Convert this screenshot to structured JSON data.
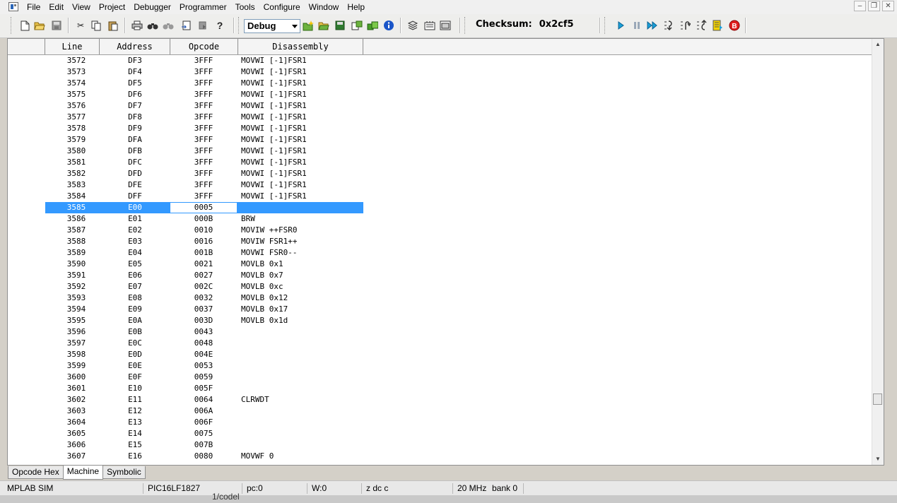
{
  "menu": [
    "File",
    "Edit",
    "View",
    "Project",
    "Debugger",
    "Programmer",
    "Tools",
    "Configure",
    "Window",
    "Help"
  ],
  "toolbar": {
    "config_select": "Debug",
    "checksum_label": "Checksum:",
    "checksum_value": "0x2cf5"
  },
  "table": {
    "headers": [
      "Line",
      "Address",
      "Opcode",
      "Disassembly"
    ],
    "selected_index": 13,
    "rows": [
      [
        "3572",
        "DF3",
        "3FFF",
        "MOVWI [-1]FSR1"
      ],
      [
        "3573",
        "DF4",
        "3FFF",
        "MOVWI [-1]FSR1"
      ],
      [
        "3574",
        "DF5",
        "3FFF",
        "MOVWI [-1]FSR1"
      ],
      [
        "3575",
        "DF6",
        "3FFF",
        "MOVWI [-1]FSR1"
      ],
      [
        "3576",
        "DF7",
        "3FFF",
        "MOVWI [-1]FSR1"
      ],
      [
        "3577",
        "DF8",
        "3FFF",
        "MOVWI [-1]FSR1"
      ],
      [
        "3578",
        "DF9",
        "3FFF",
        "MOVWI [-1]FSR1"
      ],
      [
        "3579",
        "DFA",
        "3FFF",
        "MOVWI [-1]FSR1"
      ],
      [
        "3580",
        "DFB",
        "3FFF",
        "MOVWI [-1]FSR1"
      ],
      [
        "3581",
        "DFC",
        "3FFF",
        "MOVWI [-1]FSR1"
      ],
      [
        "3582",
        "DFD",
        "3FFF",
        "MOVWI [-1]FSR1"
      ],
      [
        "3583",
        "DFE",
        "3FFF",
        "MOVWI [-1]FSR1"
      ],
      [
        "3584",
        "DFF",
        "3FFF",
        "MOVWI [-1]FSR1"
      ],
      [
        "3585",
        "E00",
        "0005",
        ""
      ],
      [
        "3586",
        "E01",
        "000B",
        "BRW"
      ],
      [
        "3587",
        "E02",
        "0010",
        "MOVIW ++FSR0"
      ],
      [
        "3588",
        "E03",
        "0016",
        "MOVIW FSR1++"
      ],
      [
        "3589",
        "E04",
        "001B",
        "MOVWI FSR0--"
      ],
      [
        "3590",
        "E05",
        "0021",
        "MOVLB 0x1"
      ],
      [
        "3591",
        "E06",
        "0027",
        "MOVLB 0x7"
      ],
      [
        "3592",
        "E07",
        "002C",
        "MOVLB 0xc"
      ],
      [
        "3593",
        "E08",
        "0032",
        "MOVLB 0x12"
      ],
      [
        "3594",
        "E09",
        "0037",
        "MOVLB 0x17"
      ],
      [
        "3595",
        "E0A",
        "003D",
        "MOVLB 0x1d"
      ],
      [
        "3596",
        "E0B",
        "0043",
        ""
      ],
      [
        "3597",
        "E0C",
        "0048",
        ""
      ],
      [
        "3598",
        "E0D",
        "004E",
        ""
      ],
      [
        "3599",
        "E0E",
        "0053",
        ""
      ],
      [
        "3600",
        "E0F",
        "0059",
        ""
      ],
      [
        "3601",
        "E10",
        "005F",
        ""
      ],
      [
        "3602",
        "E11",
        "0064",
        "CLRWDT"
      ],
      [
        "3603",
        "E12",
        "006A",
        ""
      ],
      [
        "3604",
        "E13",
        "006F",
        ""
      ],
      [
        "3605",
        "E14",
        "0075",
        ""
      ],
      [
        "3606",
        "E15",
        "007B",
        ""
      ],
      [
        "3607",
        "E16",
        "0080",
        "MOVWF 0"
      ]
    ]
  },
  "tabs": [
    {
      "label": "Opcode Hex",
      "active": false
    },
    {
      "label": "Machine",
      "active": true
    },
    {
      "label": "Symbolic",
      "active": false
    }
  ],
  "status": {
    "tool": "MPLAB SIM",
    "device": "PIC16LF1827",
    "pc": "pc:0",
    "w": "W:0",
    "flags": "z dc c",
    "freq": "20 MHz",
    "bank": "bank 0"
  },
  "background_fragment": "1/codel",
  "colors": {
    "selection": "#3399ff",
    "run_icon": "#1aa0d8",
    "break_icon": "#e02020"
  }
}
